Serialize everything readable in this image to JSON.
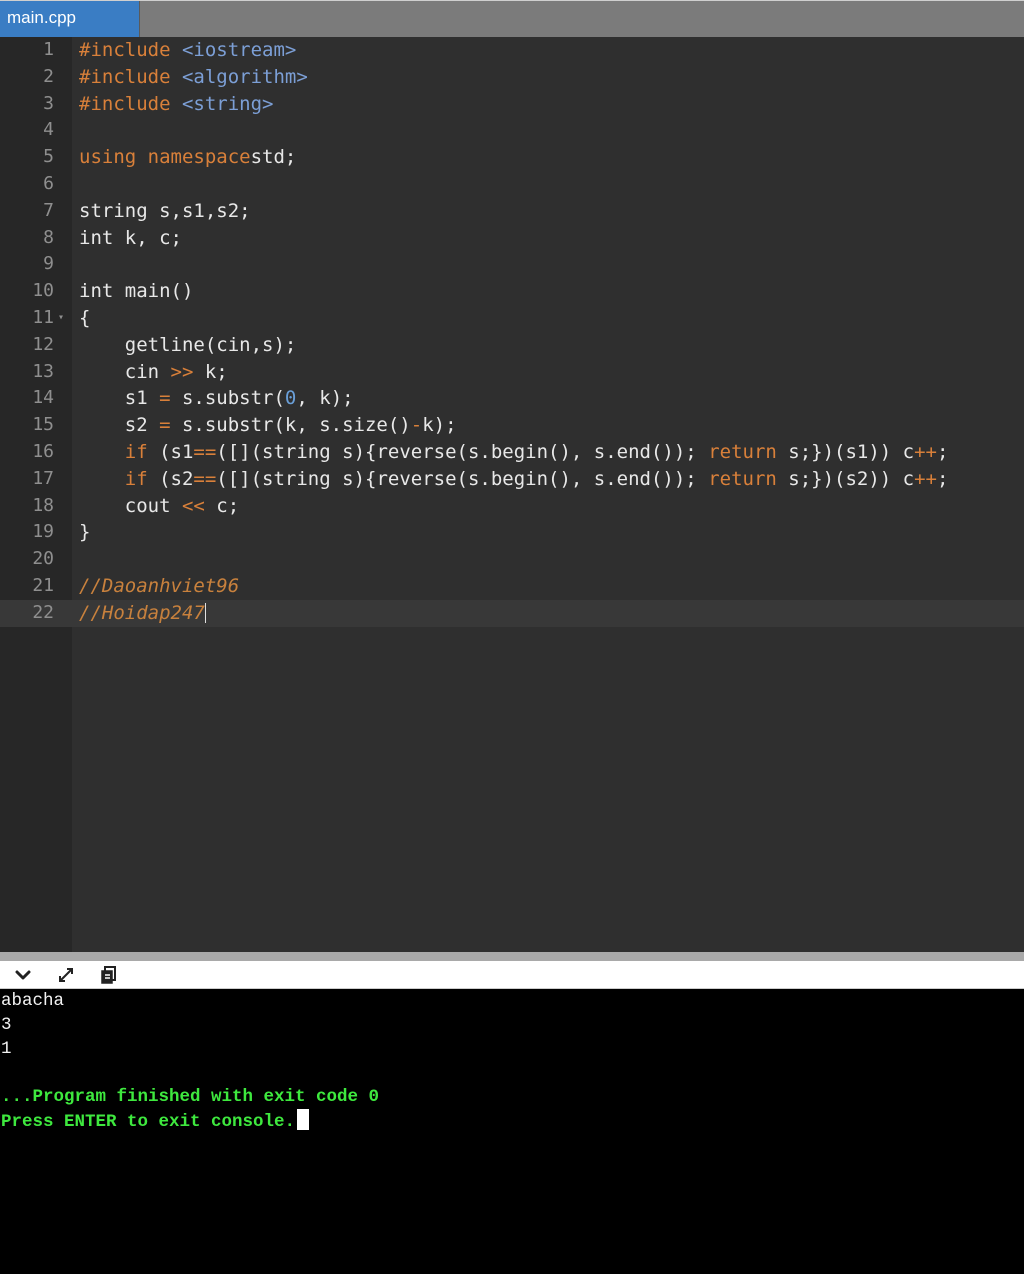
{
  "tabs": [
    {
      "label": "main.cpp",
      "active": true
    }
  ],
  "editor": {
    "lines": [
      {
        "n": "1",
        "segs": [
          [
            "pre",
            "#include "
          ],
          [
            "inc",
            "<iostream>"
          ]
        ]
      },
      {
        "n": "2",
        "segs": [
          [
            "pre",
            "#include "
          ],
          [
            "inc",
            "<algorithm>"
          ]
        ]
      },
      {
        "n": "3",
        "segs": [
          [
            "pre",
            "#include "
          ],
          [
            "inc",
            "<string>"
          ]
        ]
      },
      {
        "n": "4",
        "segs": []
      },
      {
        "n": "5",
        "segs": [
          [
            "kw",
            "using namespace"
          ],
          [
            "",
            "std;"
          ]
        ]
      },
      {
        "n": "6",
        "segs": []
      },
      {
        "n": "7",
        "segs": [
          [
            "",
            "string s,s1,s2;"
          ]
        ]
      },
      {
        "n": "8",
        "segs": [
          [
            "",
            "int k, c;"
          ]
        ]
      },
      {
        "n": "9",
        "segs": []
      },
      {
        "n": "10",
        "segs": [
          [
            "",
            "int main()"
          ]
        ]
      },
      {
        "n": "11",
        "fold": true,
        "segs": [
          [
            "",
            "{"
          ]
        ]
      },
      {
        "n": "12",
        "segs": [
          [
            "",
            "    getline(cin,s);"
          ]
        ]
      },
      {
        "n": "13",
        "segs": [
          [
            "",
            "    cin "
          ],
          [
            "op",
            ">>"
          ],
          [
            "",
            " k;"
          ]
        ]
      },
      {
        "n": "14",
        "segs": [
          [
            "",
            "    s1 "
          ],
          [
            "op",
            "="
          ],
          [
            "",
            " s.substr("
          ],
          [
            "num",
            "0"
          ],
          [
            "",
            ", k);"
          ]
        ]
      },
      {
        "n": "15",
        "segs": [
          [
            "",
            "    s2 "
          ],
          [
            "op",
            "="
          ],
          [
            "",
            " s.substr(k, s.size()"
          ],
          [
            "op",
            "-"
          ],
          [
            "",
            "k);"
          ]
        ]
      },
      {
        "n": "16",
        "segs": [
          [
            "kw",
            "    if"
          ],
          [
            "",
            " (s1"
          ],
          [
            "op",
            "=="
          ],
          [
            "",
            "([](string s){reverse(s.begin(), s.end()); "
          ],
          [
            "kw",
            "return"
          ],
          [
            "",
            " s;})(s1)) c"
          ],
          [
            "op",
            "++"
          ],
          [
            "",
            ";"
          ]
        ]
      },
      {
        "n": "17",
        "segs": [
          [
            "kw",
            "    if"
          ],
          [
            "",
            " (s2"
          ],
          [
            "op",
            "=="
          ],
          [
            "",
            "([](string s){reverse(s.begin(), s.end()); "
          ],
          [
            "kw",
            "return"
          ],
          [
            "",
            " s;})(s2)) c"
          ],
          [
            "op",
            "++"
          ],
          [
            "",
            ";"
          ]
        ]
      },
      {
        "n": "18",
        "segs": [
          [
            "",
            "    cout "
          ],
          [
            "op",
            "<<"
          ],
          [
            "",
            " c;"
          ]
        ]
      },
      {
        "n": "19",
        "segs": [
          [
            "",
            "}"
          ]
        ]
      },
      {
        "n": "20",
        "segs": []
      },
      {
        "n": "21",
        "segs": [
          [
            "cm",
            "//Daoanhviet96"
          ]
        ]
      },
      {
        "n": "22",
        "active": true,
        "segs": [
          [
            "cm",
            "//Hoidap247"
          ]
        ]
      }
    ]
  },
  "console_toolbar": {
    "collapse_icon": "chevron-down-icon",
    "expand_icon": "expand-icon",
    "copy_icon": "copy-icon"
  },
  "console": {
    "output_lines": [
      "abacha",
      "3",
      "1",
      ""
    ],
    "finish_message": "...Program finished with exit code 0",
    "exit_prompt": "Press ENTER to exit console."
  },
  "colors": {
    "keyword": "#d9803a",
    "include_path": "#7c9fd6",
    "number": "#6a9fd8",
    "comment": "#c8813d",
    "console_status": "#3ee83e",
    "tab_active": "#3a7dc4"
  }
}
